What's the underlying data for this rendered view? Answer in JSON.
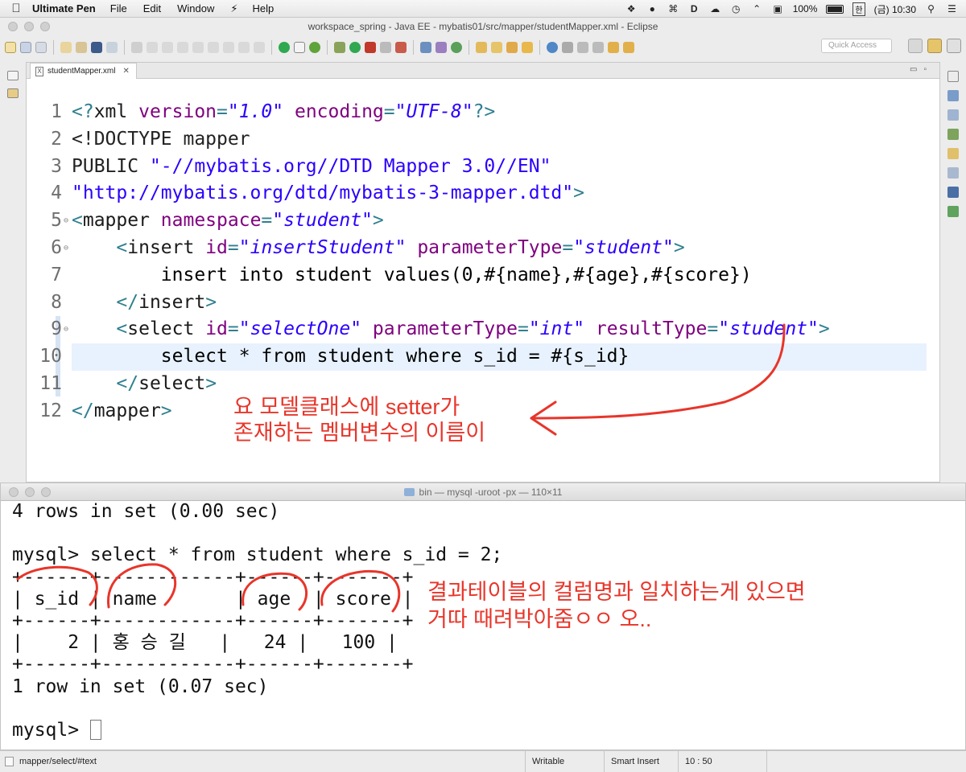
{
  "menubar": {
    "app_name": "Ultimate Pen",
    "items": [
      "File",
      "Edit",
      "Window",
      "Help"
    ],
    "battery": "100%",
    "input_lang": "한",
    "clock": "(금) 10:30"
  },
  "eclipse": {
    "title": "workspace_spring - Java EE - mybatis01/src/mapper/studentMapper.xml - Eclipse",
    "quick_access_placeholder": "Quick Access",
    "tab_label": "studentMapper.xml",
    "code_lines": [
      {
        "n": "1",
        "tokens": [
          [
            "br",
            "<?"
          ],
          [
            "tag",
            "xml "
          ],
          [
            "at",
            "version"
          ],
          [
            "br",
            "="
          ],
          [
            "val",
            "\"1.0\""
          ],
          [
            "at",
            " encoding"
          ],
          [
            "br",
            "="
          ],
          [
            "val",
            "\"UTF-8\""
          ],
          [
            "br",
            "?>"
          ]
        ]
      },
      {
        "n": "2",
        "tokens": [
          [
            "dt",
            "<!DOCTYPE mapper"
          ]
        ]
      },
      {
        "n": "3",
        "tokens": [
          [
            "dt",
            "PUBLIC "
          ],
          [
            "str",
            "\"-//mybatis.org//DTD Mapper 3.0//EN\""
          ]
        ]
      },
      {
        "n": "4",
        "tokens": [
          [
            "str",
            "\"http://mybatis.org/dtd/mybatis-3-mapper.dtd\""
          ],
          [
            "br",
            ">"
          ]
        ]
      },
      {
        "n": "5",
        "fold": true,
        "tokens": [
          [
            "br",
            "<"
          ],
          [
            "tag",
            "mapper "
          ],
          [
            "at",
            "namespace"
          ],
          [
            "br",
            "="
          ],
          [
            "val",
            "\"student\""
          ],
          [
            "br",
            ">"
          ]
        ]
      },
      {
        "n": "6",
        "fold": true,
        "tokens": [
          [
            "txt",
            "    "
          ],
          [
            "br",
            "<"
          ],
          [
            "tag",
            "insert "
          ],
          [
            "at",
            "id"
          ],
          [
            "br",
            "="
          ],
          [
            "val",
            "\"insertStudent\""
          ],
          [
            "at",
            " parameterType"
          ],
          [
            "br",
            "="
          ],
          [
            "val",
            "\"student\""
          ],
          [
            "br",
            ">"
          ]
        ]
      },
      {
        "n": "7",
        "tokens": [
          [
            "txt",
            "        insert into student values(0,#{name},#{age},#{score})"
          ]
        ]
      },
      {
        "n": "8",
        "tokens": [
          [
            "txt",
            "    "
          ],
          [
            "br",
            "</"
          ],
          [
            "tag",
            "insert"
          ],
          [
            "br",
            ">"
          ]
        ]
      },
      {
        "n": "9",
        "fold": true,
        "tokens": [
          [
            "txt",
            "    "
          ],
          [
            "br",
            "<"
          ],
          [
            "tag",
            "select "
          ],
          [
            "at",
            "id"
          ],
          [
            "br",
            "="
          ],
          [
            "val",
            "\"selectOne\""
          ],
          [
            "at",
            " parameterType"
          ],
          [
            "br",
            "="
          ],
          [
            "val",
            "\"int\""
          ],
          [
            "at",
            " resultType"
          ],
          [
            "br",
            "="
          ],
          [
            "val",
            "\"student\""
          ],
          [
            "br",
            ">"
          ]
        ]
      },
      {
        "n": "10",
        "highlight": true,
        "tokens": [
          [
            "txt",
            "        select * from student where s_id = #{s_id}"
          ]
        ]
      },
      {
        "n": "11",
        "tokens": [
          [
            "txt",
            "    "
          ],
          [
            "br",
            "</"
          ],
          [
            "tag",
            "select"
          ],
          [
            "br",
            ">"
          ]
        ]
      },
      {
        "n": "12",
        "tokens": [
          [
            "br",
            "</"
          ],
          [
            "tag",
            "mapper"
          ],
          [
            "br",
            ">"
          ]
        ]
      }
    ],
    "annotation_lines": [
      "요 모델클래스에 setter가",
      "존재하는 멤버변수의 이름이"
    ]
  },
  "terminal": {
    "title": "bin — mysql -uroot -px — 110×11",
    "lines": [
      "4 rows in set (0.00 sec)",
      "",
      "mysql> select * from student where s_id = 2;",
      "+------+------------+------+-------+",
      "| s_id | name       | age  | score |",
      "+------+------------+------+-------+",
      "|    2 | 홍 승 길   |   24 |   100 |",
      "+------+------------+------+-------+",
      "1 row in set (0.07 sec)",
      "",
      "mysql> "
    ],
    "annotation_lines": [
      "결과테이블의 컬럼명과 일치하는게 있으면",
      "거따 때려박아줌ㅇㅇ 오.."
    ]
  },
  "statusbar": {
    "path": "mapper/select/#text",
    "mode": "Writable",
    "insert": "Smart Insert",
    "position": "10 : 50"
  },
  "colors": {
    "annotation": "#e8352a",
    "attribute": "#7f007f",
    "value": "#2a00ff",
    "bracket": "#2f7f8f",
    "current_line": "#e8f2fe"
  }
}
